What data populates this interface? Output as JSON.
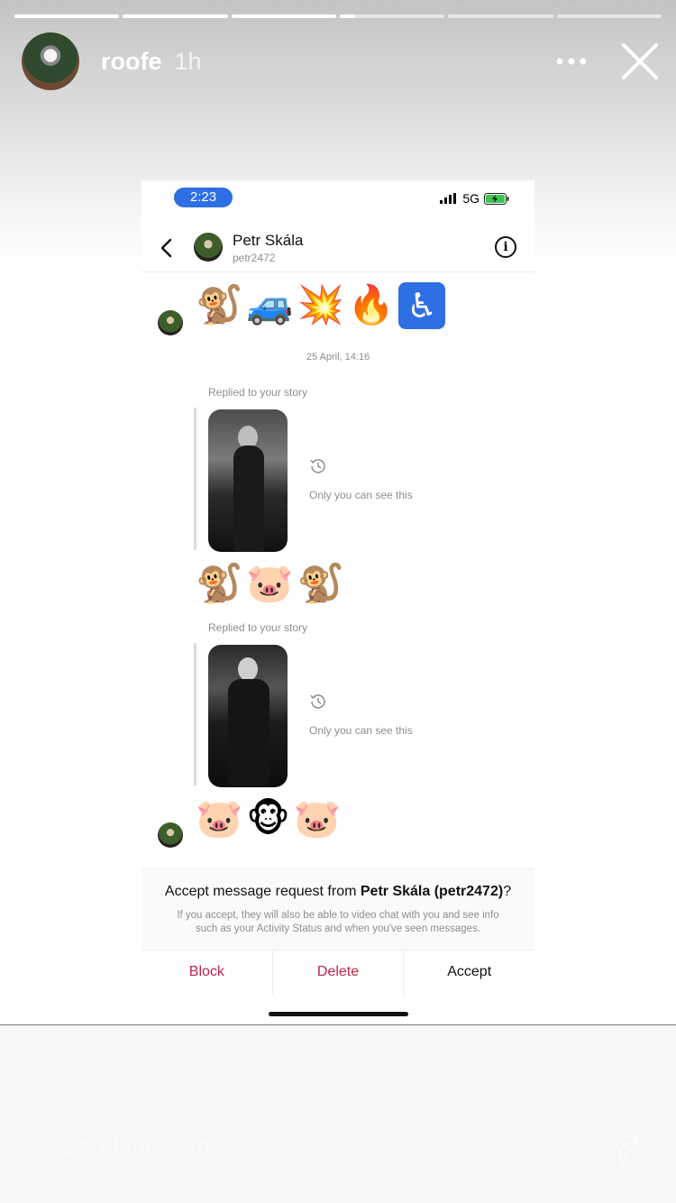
{
  "story": {
    "progress": [
      1,
      1,
      1,
      0.15,
      0,
      0
    ],
    "username": "roofe",
    "time": "1h",
    "reply_placeholder": "Send message"
  },
  "status": {
    "time": "2:23",
    "network": "5G"
  },
  "chat": {
    "name": "Petr Skála",
    "handle": "petr2472",
    "messages": {
      "row1": [
        "🐒",
        "🚙",
        "💥",
        "🔥",
        "♿"
      ],
      "timestamp": "25 April, 14:16",
      "replied_label": "Replied to your story",
      "only_you": "Only you can see this",
      "row2": [
        "🐒",
        "🐷",
        "🐒"
      ],
      "row3": [
        "🐷",
        "🐵",
        "🐷"
      ]
    }
  },
  "request": {
    "prefix": "Accept message request from ",
    "who": "Petr Skála (petr2472)",
    "suffix": "?",
    "body": "If you accept, they will also be able to video chat with you and see info such as your Activity Status and when you've seen messages.",
    "block": "Block",
    "delete": "Delete",
    "accept": "Accept"
  },
  "colors": {
    "status_pill": "#2f6fe4",
    "danger": "#c0234a"
  }
}
